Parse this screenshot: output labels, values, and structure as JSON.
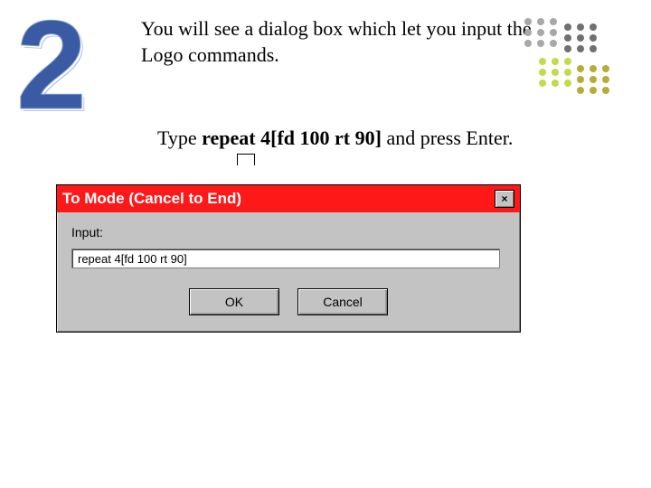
{
  "step_number": "2",
  "instruction_line1": "You will see a dialog box which let you input the Logo commands.",
  "instruction_line2_pre": "Type ",
  "instruction_line2_bold": "repeat 4[fd 100 rt 90]",
  "instruction_line2_post": " and press Enter.",
  "dialog": {
    "title": "To Mode (Cancel to End)",
    "close_label": "×",
    "input_label": "Input:",
    "input_value": "repeat 4[fd 100 rt 90]",
    "ok_label": "OK",
    "cancel_label": "Cancel"
  }
}
